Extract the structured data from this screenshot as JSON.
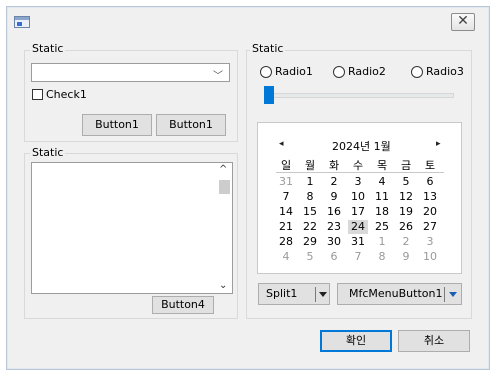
{
  "window": {
    "close_glyph": "✕",
    "app_icon": "window-app-icon"
  },
  "left_top_group": {
    "label": "Static",
    "combo_value": "",
    "checkbox_label": "Check1",
    "button1_label": "Button1",
    "button2_label": "Button1"
  },
  "left_bottom_group": {
    "label": "Static",
    "button_label": "Button4"
  },
  "right_group": {
    "label": "Static",
    "radios": [
      {
        "label": "Radio1"
      },
      {
        "label": "Radio2"
      },
      {
        "label": "Radio3"
      }
    ],
    "slider_level": 0
  },
  "calendar": {
    "title": "2024년 1월",
    "prev_glyph": "◂",
    "next_glyph": "▸",
    "weekdays": [
      "일",
      "월",
      "화",
      "수",
      "목",
      "금",
      "토"
    ],
    "weeks": [
      [
        "31",
        "1",
        "2",
        "3",
        "4",
        "5",
        "6"
      ],
      [
        "7",
        "8",
        "9",
        "10",
        "11",
        "12",
        "13"
      ],
      [
        "14",
        "15",
        "16",
        "17",
        "18",
        "19",
        "20"
      ],
      [
        "21",
        "22",
        "23",
        "24",
        "25",
        "26",
        "27"
      ],
      [
        "28",
        "29",
        "30",
        "31",
        "1",
        "2",
        "3"
      ],
      [
        "4",
        "5",
        "6",
        "7",
        "8",
        "9",
        "10"
      ]
    ]
  },
  "split_button": {
    "label": "Split1"
  },
  "menu_button": {
    "label": "MfcMenuButton1"
  },
  "footer": {
    "ok_label": "확인",
    "cancel_label": "취소"
  },
  "colors": {
    "accent": "#0078d7",
    "dialog_bg": "#f0f0f0"
  }
}
